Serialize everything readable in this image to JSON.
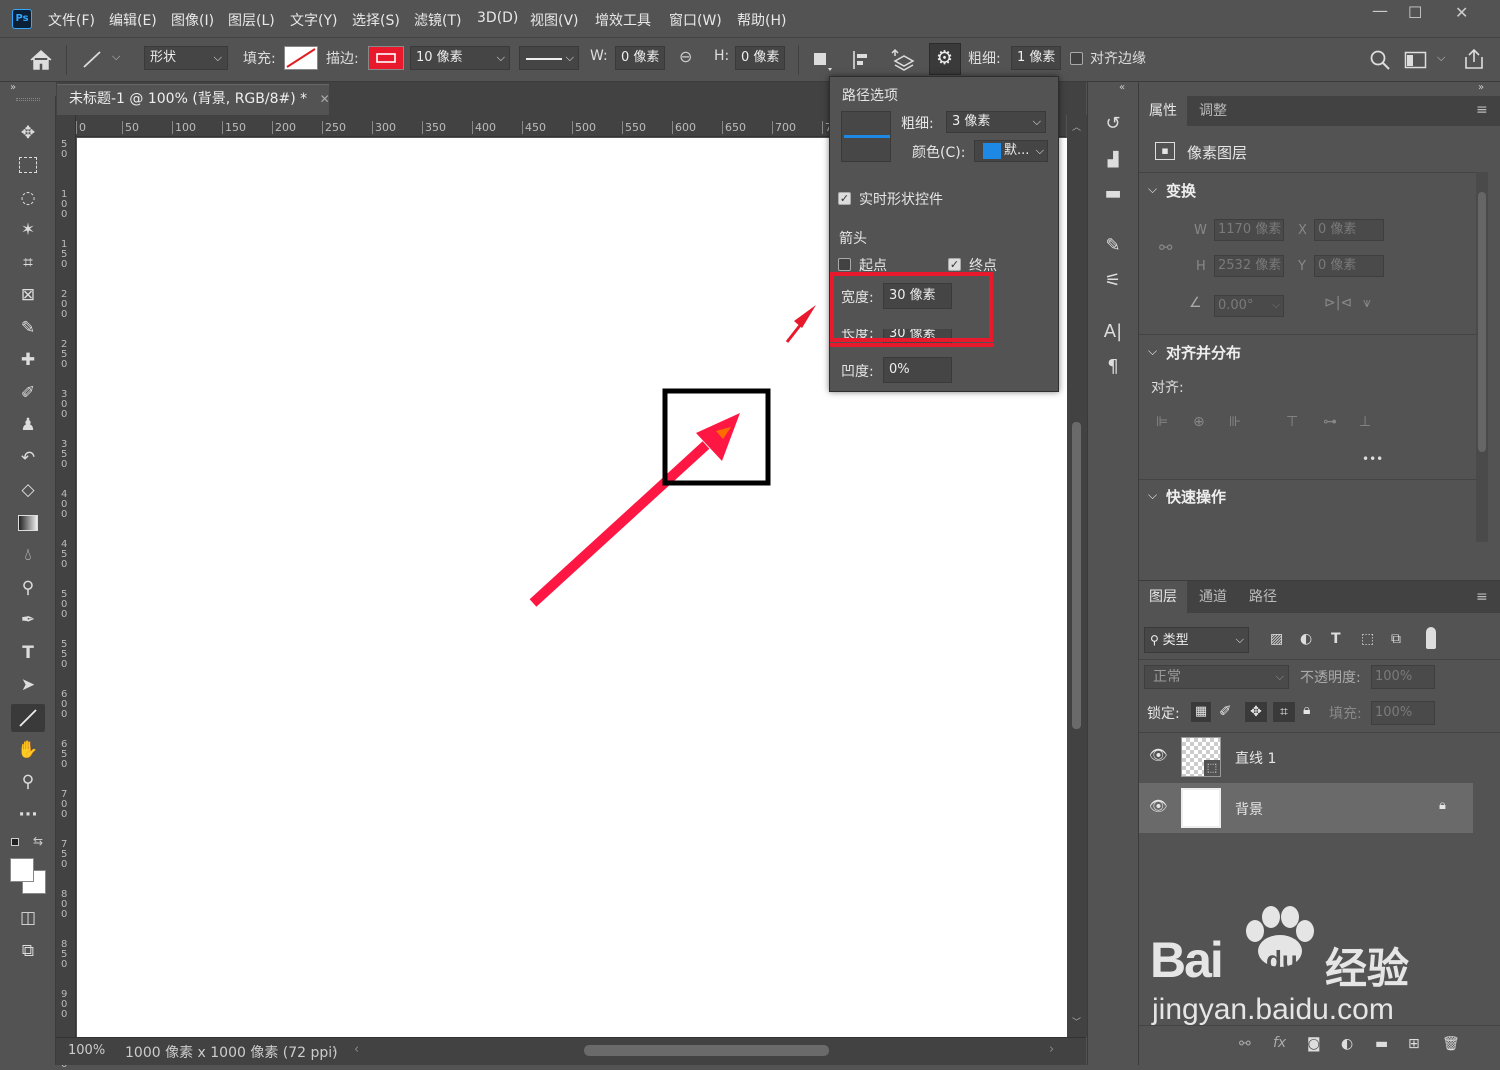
{
  "app": {
    "logo": "Ps"
  },
  "menu": [
    "文件(F)",
    "编辑(E)",
    "图像(I)",
    "图层(L)",
    "文字(Y)",
    "选择(S)",
    "滤镜(T)",
    "3D(D)",
    "视图(V)",
    "增效工具",
    "窗口(W)",
    "帮助(H)"
  ],
  "window_controls": {
    "minimize": "—",
    "maximize": "☐",
    "close": "✕"
  },
  "options": {
    "mode": "形状",
    "fill_label": "填充:",
    "stroke_label": "描边:",
    "stroke_width": "10 像素",
    "w_label": "W:",
    "w_value": "0 像素",
    "h_label": "H:",
    "h_value": "0 像素",
    "weight_label": "粗细:",
    "weight_value": "1 像素",
    "align_edges": "对齐边缘"
  },
  "document": {
    "tab_title": "未标题-1 @ 100% (背景, RGB/8#) *",
    "ruler_top": [
      "0",
      "50",
      "100",
      "150",
      "200",
      "250",
      "300",
      "350",
      "400",
      "450",
      "500",
      "550",
      "600",
      "650",
      "700",
      "7"
    ],
    "ruler_left": [
      "50",
      "100",
      "150",
      "200",
      "250",
      "300",
      "350",
      "400",
      "450",
      "500",
      "550",
      "600",
      "650",
      "700",
      "750",
      "800",
      "850",
      "900",
      "950"
    ],
    "zoom": "100%",
    "info": "1000 像素 x 1000 像素 (72 ppi)"
  },
  "path_options": {
    "title": "路径选项",
    "weight_label": "粗细:",
    "weight_value": "3 像素",
    "color_label": "颜色(C):",
    "color_value": "默...",
    "live_shape": "实时形状控件",
    "arrow_label": "箭头",
    "start_label": "起点",
    "end_label": "终点",
    "width_label": "宽度:",
    "width_value": "30 像素",
    "length_label": "长度:",
    "length_value": "30 像素",
    "concavity_label": "凹度:",
    "concavity_value": "0%"
  },
  "properties": {
    "tab_properties": "属性",
    "tab_adjust": "调整",
    "layer_kind": "像素图层",
    "transform": "变换",
    "w_label": "W",
    "w_value": "1170 像素",
    "x_label": "X",
    "x_value": "0 像素",
    "h_label": "H",
    "h_value": "2532 像素",
    "y_label": "Y",
    "y_value": "0 像素",
    "angle": "0.00°",
    "align_dist": "对齐并分布",
    "align_label": "对齐:",
    "more": "•••",
    "quick_actions": "快速操作"
  },
  "layers_panel": {
    "tab_layers": "图层",
    "tab_channels": "通道",
    "tab_paths": "路径",
    "filter_kind": "类型",
    "blend_mode": "正常",
    "opacity_label": "不透明度:",
    "opacity_value": "100%",
    "lock_label": "锁定:",
    "fill_label": "填充:",
    "fill_value": "100%",
    "layers": [
      {
        "name": "直线 1"
      },
      {
        "name": "背景"
      }
    ]
  },
  "watermark": {
    "brand": "Bai",
    "brand2": "du",
    "cn": "经验",
    "url": "jingyan.baidu.com"
  },
  "colors": {
    "arrow": "#ff1744",
    "highlight": "#e8192c",
    "accent": "#1e88e5",
    "chrome": "#535353"
  }
}
